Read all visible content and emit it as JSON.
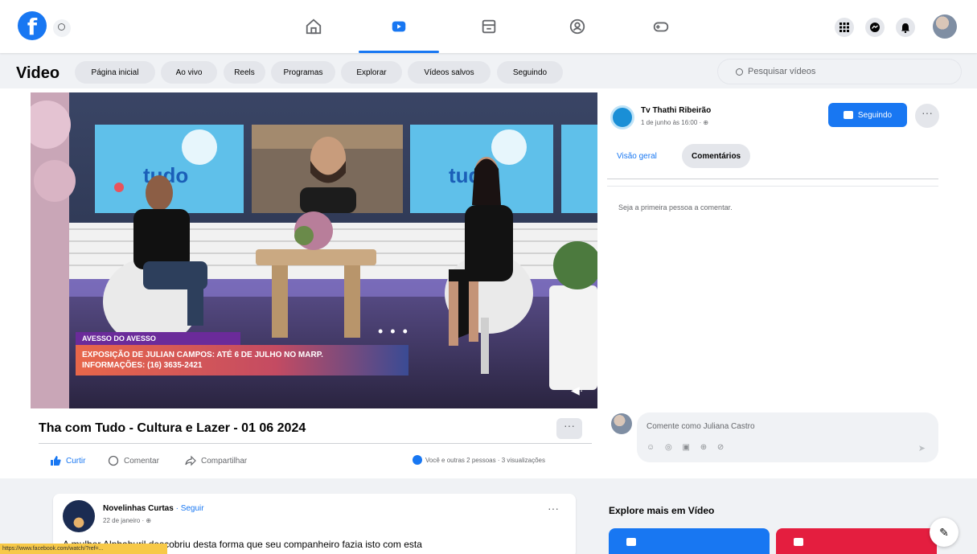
{
  "nav": {
    "logo_letter": "f",
    "tabs": [
      "home-icon",
      "video-icon",
      "marketplace-icon",
      "groups-icon",
      "gaming-icon"
    ],
    "right": [
      "menu-icon",
      "messenger-icon",
      "notifications-icon"
    ]
  },
  "video_header": {
    "title": "Video",
    "chips": [
      "Página inicial",
      "Ao vivo",
      "Reels",
      "Programas",
      "Explorar",
      "Vídeos salvos",
      "Seguindo"
    ],
    "search_placeholder": "Pesquisar vídeos"
  },
  "player": {
    "lower_third_tag": "AVESSO DO AVESSO",
    "lower_third_line1": "EXPOSIÇÃO DE JULIAN CAMPOS: ATÉ 6 DE JULHO NO MARP.",
    "lower_third_line2": "INFORMAÇÕES: (16) 3635-2421",
    "set_logo": "tudo",
    "more": "• • •",
    "volume": "◀·"
  },
  "post": {
    "title": "Tha com Tudo - Cultura e Lazer - 01 06 2024",
    "more": "···",
    "like": "Curtir",
    "comment": "Comentar",
    "share": "Compartilhar",
    "reactions": "Você e outras 2 pessoas · 3 visualizações"
  },
  "side": {
    "channel": "Tv Thathi Ribeirão",
    "date": "1 de junho às 16:00 · ",
    "date_icon": "globe-icon",
    "follow": "Seguindo",
    "more": "···",
    "tab_overview": "Visão geral",
    "tab_comments": "Comentários",
    "empty": "Seja a primeira pessoa a comentar.",
    "comment_placeholder": "Comente como Juliana Castro",
    "comment_icons": "☺ ◎ ▣ ⊕ ⊘",
    "send": "➤"
  },
  "post2": {
    "author": "Novelinhas Curtas",
    "follow": " · Seguir",
    "date": "22 de janeiro · ",
    "more": "···",
    "text": "A mulher Alphaburil descobriu desta forma que seu companheiro fazia isto com esta"
  },
  "explore": {
    "title": "Explore mais em Vídeo"
  },
  "compose": "✎",
  "status_url": "https://www.facebook.com/watch/?ref=..."
}
